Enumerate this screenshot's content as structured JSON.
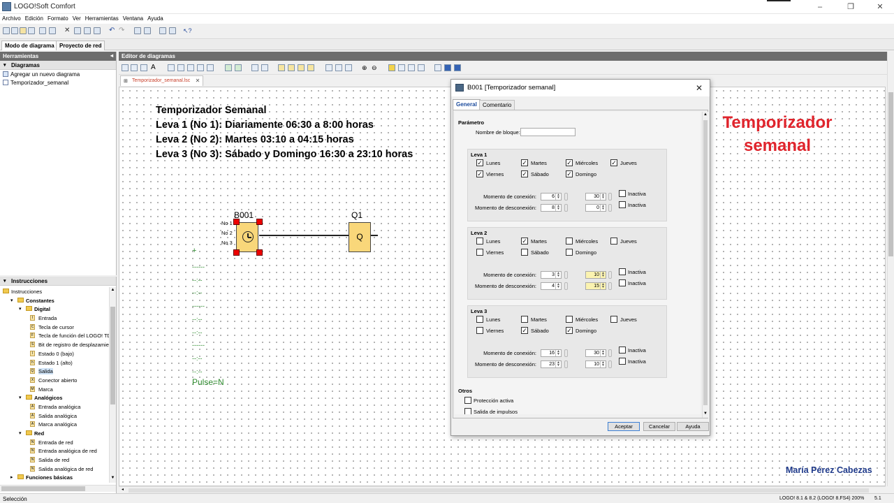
{
  "window": {
    "title": "LOGO!Soft Comfort"
  },
  "menu": [
    "Archivo",
    "Edición",
    "Formato",
    "Ver",
    "Herramientas",
    "Ventana",
    "Ayuda"
  ],
  "mode_tabs": [
    "Modo de diagrama",
    "Proyecto de red"
  ],
  "tools_panel": {
    "title": "Herramientas",
    "section": "Diagramas",
    "items": [
      "Agregar un nuevo diagrama",
      "Temporizador_semanal"
    ]
  },
  "instructions_panel": {
    "title": "Instrucciones",
    "tree": [
      {
        "label": "Instrucciones",
        "level": 0,
        "kind": "folder",
        "caret": "–"
      },
      {
        "label": "Constantes",
        "level": 1,
        "kind": "folder",
        "caret": "▾",
        "bold": true
      },
      {
        "label": "Digital",
        "level": 2,
        "kind": "folder",
        "caret": "▾",
        "bold": true
      },
      {
        "label": "Entrada",
        "level": 3,
        "kind": "block",
        "code": "I"
      },
      {
        "label": "Tecla de cursor",
        "level": 3,
        "kind": "block",
        "code": "C"
      },
      {
        "label": "Tecla de función del LOGO! TD",
        "level": 3,
        "kind": "block",
        "code": "F"
      },
      {
        "label": "Bit de registro de desplazamient",
        "level": 3,
        "kind": "block",
        "code": "S"
      },
      {
        "label": "Estado 0 (bajo)",
        "level": 3,
        "kind": "block",
        "code": "lo"
      },
      {
        "label": "Estado 1 (alto)",
        "level": 3,
        "kind": "block",
        "code": "hi"
      },
      {
        "label": "Salida",
        "level": 3,
        "kind": "block",
        "code": "Q",
        "selected": true
      },
      {
        "label": "Conector abierto",
        "level": 3,
        "kind": "block",
        "code": "X"
      },
      {
        "label": "Marca",
        "level": 3,
        "kind": "block",
        "code": "M"
      },
      {
        "label": "Analógicos",
        "level": 2,
        "kind": "folder",
        "caret": "▾",
        "bold": true
      },
      {
        "label": "Entrada analógica",
        "level": 3,
        "kind": "block",
        "code": "AI"
      },
      {
        "label": "Salida analógica",
        "level": 3,
        "kind": "block",
        "code": "AQ"
      },
      {
        "label": "Marca analógica",
        "level": 3,
        "kind": "block",
        "code": "AM"
      },
      {
        "label": "Red",
        "level": 2,
        "kind": "folder",
        "caret": "▾",
        "bold": true
      },
      {
        "label": "Entrada de red",
        "level": 3,
        "kind": "block",
        "code": "NI"
      },
      {
        "label": "Entrada analógica de red",
        "level": 3,
        "kind": "block",
        "code": "NA"
      },
      {
        "label": "Salida de red",
        "level": 3,
        "kind": "block",
        "code": "NQ"
      },
      {
        "label": "Salida analógica de red",
        "level": 3,
        "kind": "block",
        "code": "NA"
      },
      {
        "label": "Funciones básicas",
        "level": 1,
        "kind": "folder",
        "caret": "▸",
        "bold": true
      }
    ]
  },
  "editor": {
    "title": "Editor de diagramas",
    "file_tab": "Temporizador_semanal.lsc",
    "description": [
      "Temporizador Semanal",
      "Leva 1 (No 1): Diariamente 06:30 a 8:00 horas",
      "Leva 2 (No 2): Martes 03:10 a 04:15 horas",
      "Leva 3 (No 3): Sábado y Domingo 16:30 a 23:10 horas"
    ],
    "block_name": "B001",
    "block_inputs": [
      "No 1",
      "No 2",
      "No 3"
    ],
    "output_name": "Q1",
    "output_symbol": "Q",
    "pulse_label": "Pulse=N",
    "overlay_title": "Temporizador semanal",
    "author": "María Pérez Cabezas"
  },
  "dialog": {
    "title": "B001 [Temporizador semanal]",
    "tabs": [
      "General",
      "Comentario"
    ],
    "parametro_label": "Parámetro",
    "block_name_label": "Nombre de bloque:",
    "block_name_value": "",
    "days": [
      "Lunes",
      "Martes",
      "Miércoles",
      "Jueves",
      "Viernes",
      "Sábado",
      "Domingo"
    ],
    "on_label": "Momento de conexión:",
    "off_label": "Momento de desconexión:",
    "inactive_label": "Inactiva",
    "levas": [
      {
        "name": "Leva 1",
        "checked": [
          true,
          true,
          true,
          true,
          true,
          true,
          true
        ],
        "on_h": "6",
        "on_m": "30",
        "off_h": "8",
        "off_m": "0"
      },
      {
        "name": "Leva 2",
        "checked": [
          false,
          true,
          false,
          false,
          false,
          false,
          false
        ],
        "on_h": "3",
        "on_m": "10",
        "off_h": "4",
        "off_m": "15"
      },
      {
        "name": "Leva 3",
        "checked": [
          false,
          false,
          false,
          false,
          false,
          true,
          true
        ],
        "on_h": "16",
        "on_m": "30",
        "off_h": "23",
        "off_m": "10"
      }
    ],
    "otros_label": "Otros",
    "proteccion_label": "Protección activa",
    "salida_impulsos_label": "Salida de impulsos",
    "buttons": [
      "Aceptar",
      "Cancelar",
      "Ayuda"
    ]
  },
  "status": {
    "left": "Selección",
    "right": "LOGO! 8.1 & 8.2 (LOGO! 8.FS4) 200%",
    "extra": "5.1"
  },
  "colors": {
    "accent_red": "#e0242c",
    "author_blue": "#1f3a8a",
    "pulse_green": "#2e8b2e"
  }
}
